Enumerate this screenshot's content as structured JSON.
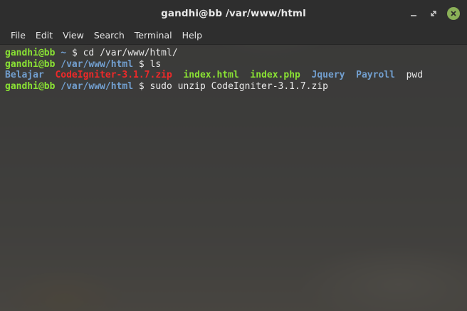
{
  "window": {
    "title": "gandhi@bb /var/www/html",
    "controls": {
      "minimize_icon": "minimize-icon",
      "maximize_icon": "maximize-icon",
      "close_icon": "close-icon",
      "close_color": "#8bb158"
    }
  },
  "menubar": {
    "items": [
      "File",
      "Edit",
      "View",
      "Search",
      "Terminal",
      "Help"
    ]
  },
  "terminal": {
    "colors": {
      "user": "#8ae234",
      "path": "#729fcf",
      "zip": "#ef2929",
      "executable": "#8ae234",
      "text": "#e8e8e8",
      "background": "#343434"
    },
    "lines": [
      {
        "user": "gandhi@bb",
        "path": " ~ ",
        "prompt": "$",
        "command": " cd /var/www/html/"
      },
      {
        "user": "gandhi@bb",
        "path": " /var/www/html ",
        "prompt": "$",
        "command": " ls"
      },
      {
        "listing": [
          {
            "name": "Belajar",
            "type": "dir"
          },
          {
            "name": "CodeIgniter-3.1.7.zip",
            "type": "zip"
          },
          {
            "name": "index.html",
            "type": "exec"
          },
          {
            "name": "index.php",
            "type": "exec"
          },
          {
            "name": "Jquery",
            "type": "dir"
          },
          {
            "name": "Payroll",
            "type": "dir"
          },
          {
            "name": "pwd",
            "type": "file"
          }
        ]
      },
      {
        "user": "gandhi@bb",
        "path": " /var/www/html ",
        "prompt": "$",
        "command": " sudo unzip CodeIgniter-3.1.7.zip"
      }
    ]
  }
}
